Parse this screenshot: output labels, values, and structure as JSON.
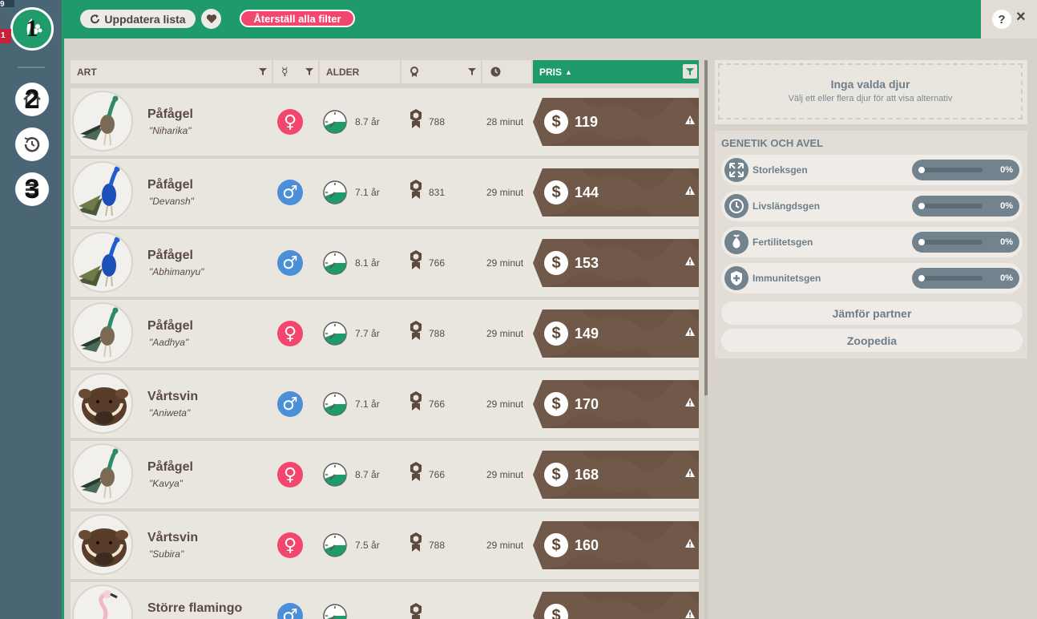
{
  "corner": {
    "top_number": "9",
    "badge_number": "1"
  },
  "sidebar": {
    "logo_number": "1",
    "buttons": [
      {
        "icon": "home-icon",
        "number": "2"
      },
      {
        "icon": "history-icon",
        "number": ""
      },
      {
        "icon": "list-icon",
        "number": "3"
      }
    ]
  },
  "toolbar": {
    "refresh_label": "Uppdatera lista",
    "reset_filters_label": "Återställ alla filter"
  },
  "window": {
    "help_label": "?",
    "close_label": "×"
  },
  "table": {
    "headers": {
      "species": "ART",
      "gender": "",
      "age": "ALDER",
      "reputation": "",
      "time": "",
      "price": "PRIS"
    },
    "rows": [
      {
        "species": "Påfågel",
        "name": "\"Niharika\"",
        "gender": "female",
        "gender_symbol": "♀",
        "age": "8.7 år",
        "reputation": "788",
        "time": "28 minut",
        "price": "119",
        "avatar": "peafowl-female"
      },
      {
        "species": "Påfågel",
        "name": "\"Devansh\"",
        "gender": "male",
        "gender_symbol": "♂",
        "age": "7.1 år",
        "reputation": "831",
        "time": "29 minut",
        "price": "144",
        "avatar": "peafowl-male"
      },
      {
        "species": "Påfågel",
        "name": "\"Abhimanyu\"",
        "gender": "male",
        "gender_symbol": "♂",
        "age": "8.1 år",
        "reputation": "766",
        "time": "29 minut",
        "price": "153",
        "avatar": "peafowl-male"
      },
      {
        "species": "Påfågel",
        "name": "\"Aadhya\"",
        "gender": "female",
        "gender_symbol": "♀",
        "age": "7.7 år",
        "reputation": "788",
        "time": "29 minut",
        "price": "149",
        "avatar": "peafowl-female"
      },
      {
        "species": "Vårtsvin",
        "name": "\"Aniweta\"",
        "gender": "male",
        "gender_symbol": "♂",
        "age": "7.1 år",
        "reputation": "766",
        "time": "29 minut",
        "price": "170",
        "avatar": "warthog"
      },
      {
        "species": "Påfågel",
        "name": "\"Kavya\"",
        "gender": "female",
        "gender_symbol": "♀",
        "age": "8.7 år",
        "reputation": "766",
        "time": "29 minut",
        "price": "168",
        "avatar": "peafowl-female"
      },
      {
        "species": "Vårtsvin",
        "name": "\"Subira\"",
        "gender": "female",
        "gender_symbol": "♀",
        "age": "7.5 år",
        "reputation": "788",
        "time": "29 minut",
        "price": "160",
        "avatar": "warthog"
      },
      {
        "species": "Större flamingo",
        "name": "",
        "gender": "male",
        "gender_symbol": "♂",
        "age": "",
        "reputation": "",
        "time": "",
        "price": "",
        "avatar": "flamingo"
      }
    ]
  },
  "selection": {
    "title": "Inga valda djur",
    "subtitle": "Välj ett eller flera djur för att visa alternativ"
  },
  "genetics": {
    "title": "GENETIK OCH AVEL",
    "genes": [
      {
        "label": "Storleksgen",
        "value": "0%",
        "icon": "size-icon"
      },
      {
        "label": "Livslängdsgen",
        "value": "0%",
        "icon": "lifespan-icon"
      },
      {
        "label": "Fertilitetsgen",
        "value": "0%",
        "icon": "fertility-icon"
      },
      {
        "label": "Immunitetsgen",
        "value": "0%",
        "icon": "immunity-icon"
      }
    ],
    "compare_label": "Jämför partner",
    "zoopedia_label": "Zoopedia"
  },
  "colors": {
    "accent": "#1e9a6b",
    "female": "#f2466e",
    "male": "#4a8fd8",
    "price_tag": "#6b5444"
  }
}
